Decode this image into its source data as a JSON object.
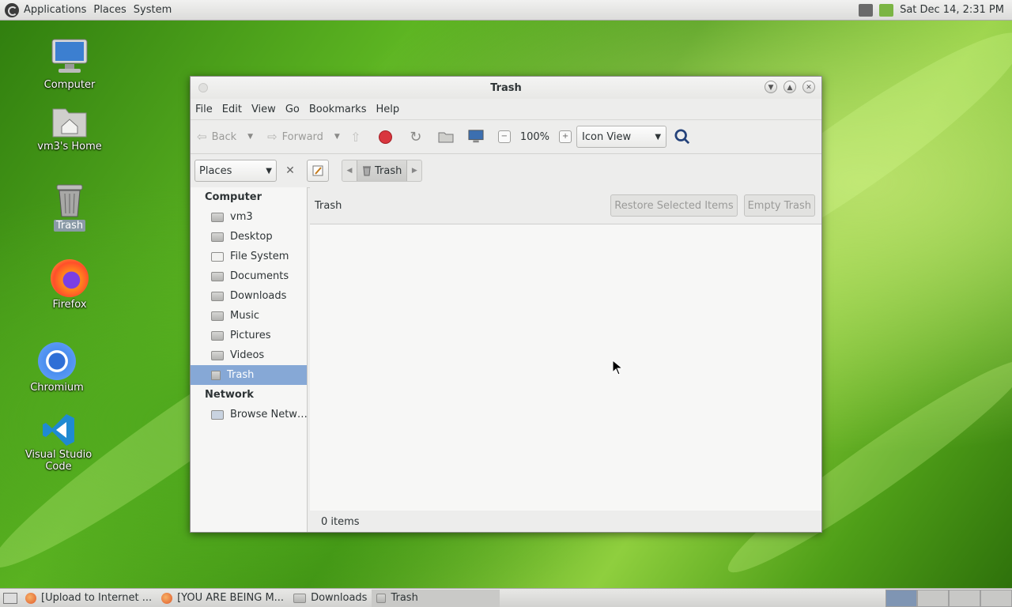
{
  "top_panel": {
    "menus": [
      "Applications",
      "Places",
      "System"
    ],
    "clock": "Sat Dec 14,  2:31 PM"
  },
  "desktop_icons": [
    {
      "label": "Computer"
    },
    {
      "label": "vm3's Home"
    },
    {
      "label": "Trash"
    },
    {
      "label": "Firefox"
    },
    {
      "label": "Chromium"
    },
    {
      "label": "Visual Studio Code"
    }
  ],
  "window": {
    "title": "Trash",
    "menubar": [
      "File",
      "Edit",
      "View",
      "Go",
      "Bookmarks",
      "Help"
    ],
    "toolbar": {
      "back_label": "Back",
      "forward_label": "Forward",
      "zoom": "100%",
      "view_mode": "Icon View"
    },
    "location": {
      "places_label": "Places",
      "crumb": "Trash"
    },
    "sidebar": {
      "computer_header": "Computer",
      "computer_items": [
        "vm3",
        "Desktop",
        "File System",
        "Documents",
        "Downloads",
        "Music",
        "Pictures",
        "Videos",
        "Trash"
      ],
      "network_header": "Network",
      "network_items": [
        "Browse Netw…"
      ]
    },
    "main": {
      "header_label": "Trash",
      "restore_button": "Restore Selected Items",
      "empty_button": "Empty Trash",
      "status": "0 items"
    }
  },
  "taskbar": {
    "tasks": [
      "[Upload to Internet ...",
      "[YOU ARE BEING M...",
      "Downloads",
      "Trash"
    ]
  }
}
